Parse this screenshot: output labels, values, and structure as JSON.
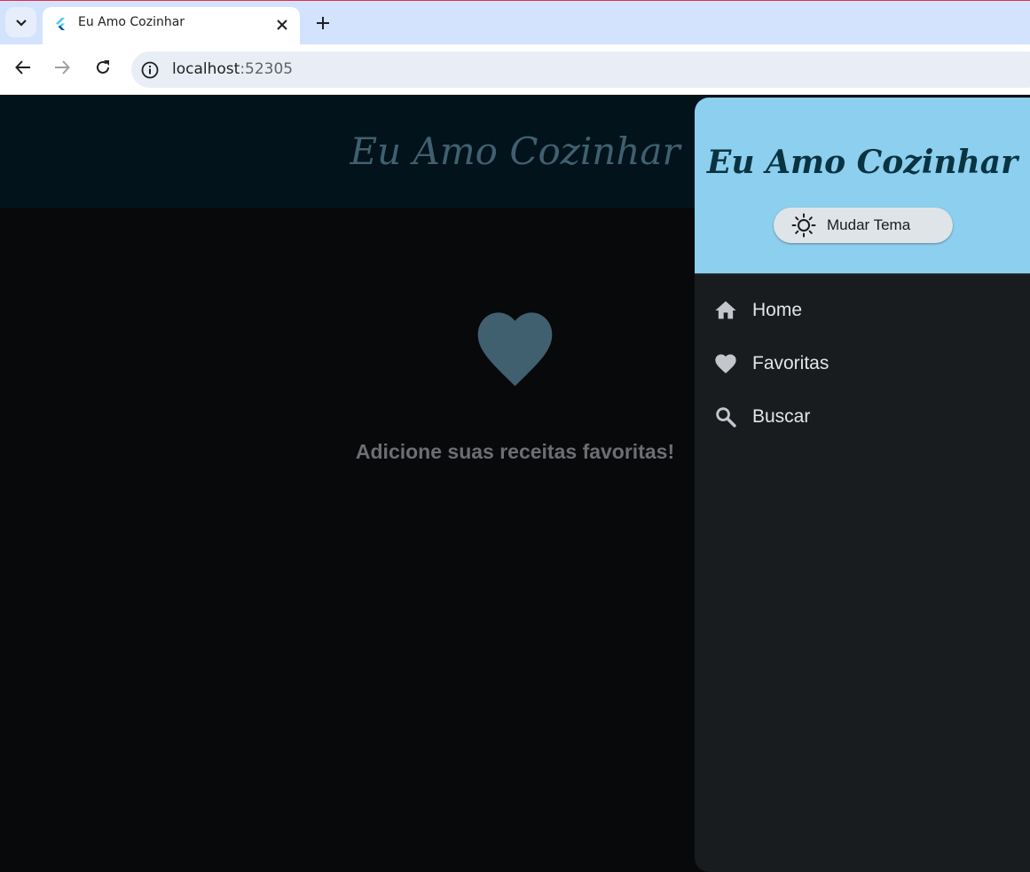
{
  "browser": {
    "tab_title": "Eu Amo Cozinhar",
    "url_host": "localhost",
    "url_port": ":52305",
    "icons": {
      "tab_search": "chevron-down-icon",
      "favicon": "flutter-logo-icon",
      "close": "close-icon",
      "new_tab": "plus-icon",
      "back": "arrow-left-icon",
      "forward": "arrow-right-icon",
      "reload": "reload-icon",
      "site_info": "info-icon"
    }
  },
  "app": {
    "title": "Eu Amo Cozinhar",
    "empty_message": "Adicione suas receitas favoritas!",
    "empty_icon": "heart-icon"
  },
  "drawer": {
    "title": "Eu Amo Cozinhar",
    "theme_button": {
      "label": "Mudar Tema",
      "icon": "sun-icon"
    },
    "items": [
      {
        "label": "Home",
        "icon": "home-icon"
      },
      {
        "label": "Favoritas",
        "icon": "heart-icon"
      },
      {
        "label": "Buscar",
        "icon": "search-icon"
      }
    ]
  },
  "colors": {
    "app_bar": "#03131b",
    "background": "#08090b",
    "drawer_header": "#8ccfee",
    "drawer_body": "#181c1f",
    "accent_heart": "#406070",
    "tab_strip": "#d3e3fd"
  }
}
